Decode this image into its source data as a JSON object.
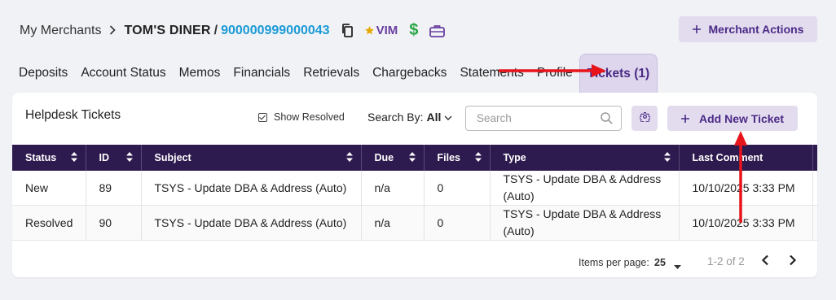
{
  "breadcrumb": {
    "root": "My Merchants",
    "merchant_name": "TOM'S DINER",
    "slash": "/",
    "merchant_id": "900000999000043",
    "vim_label": "VIM"
  },
  "header": {
    "merchant_actions_label": "Merchant Actions"
  },
  "tabs": [
    {
      "label": "Deposits"
    },
    {
      "label": "Account Status"
    },
    {
      "label": "Memos"
    },
    {
      "label": "Financials"
    },
    {
      "label": "Retrievals"
    },
    {
      "label": "Chargebacks"
    },
    {
      "label": "Statements"
    },
    {
      "label": "Profile"
    },
    {
      "label": "Tickets (1)",
      "active": true
    }
  ],
  "panel": {
    "title": "Helpdesk Tickets",
    "show_resolved_label": "Show Resolved",
    "show_resolved_checked": true,
    "search_by_label": "Search By:",
    "search_by_value": "All",
    "search_placeholder": "Search",
    "add_ticket_label": "Add New Ticket"
  },
  "table": {
    "columns": [
      "Status",
      "ID",
      "Subject",
      "Due",
      "Files",
      "Type",
      "Last Comment"
    ],
    "rows": [
      {
        "status": "New",
        "id": "89",
        "subject": "TSYS - Update DBA & Address (Auto)",
        "due": "n/a",
        "files": "0",
        "type": "TSYS - Update DBA & Address (Auto)",
        "last_comment": "10/10/2025 3:33 PM"
      },
      {
        "status": "Resolved",
        "id": "90",
        "subject": "TSYS - Update DBA & Address (Auto)",
        "due": "n/a",
        "files": "0",
        "type": "TSYS - Update DBA & Address (Auto)",
        "last_comment": "10/10/2025 3:33 PM"
      }
    ]
  },
  "pagination": {
    "items_per_page_label": "Items per page:",
    "items_per_page_value": "25",
    "range_label": "1-2 of 2"
  },
  "colors": {
    "accent": "#4b2a86",
    "accent_light": "#e3dcef",
    "table_header": "#2d1a4e",
    "link_blue": "#1a9ad6",
    "annotation_red": "#e8141b"
  }
}
